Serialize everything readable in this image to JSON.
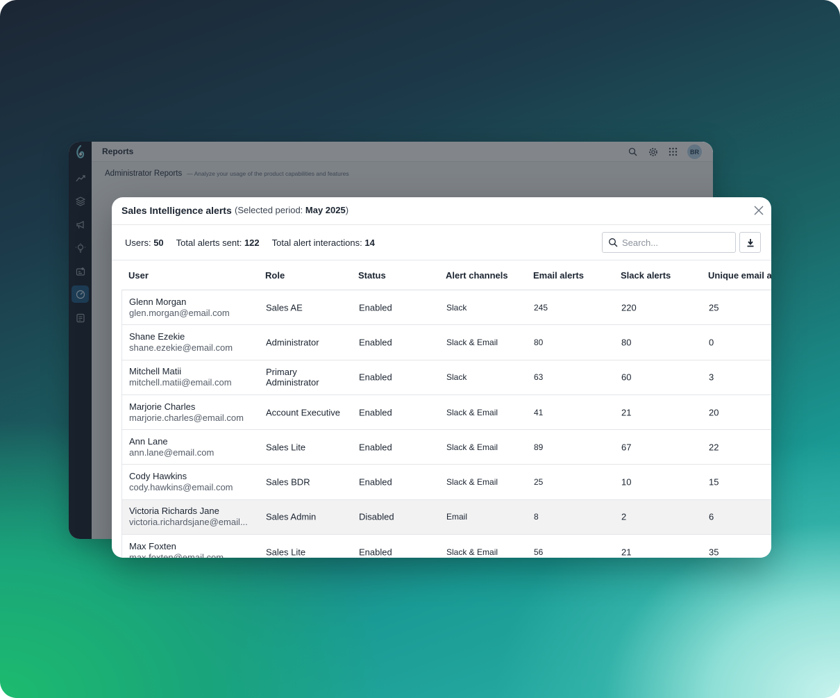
{
  "app": {
    "title": "Reports",
    "avatar_initials": "BR",
    "subtitle": "Administrator Reports",
    "subtitle_desc": "— Analyze your usage of the product capabilities and features",
    "sidebar_icons": [
      "trend-icon",
      "layers-icon",
      "megaphone-icon",
      "lightbulb-icon",
      "id-card-icon",
      "gauge-icon",
      "report-icon"
    ],
    "active_sidebar": "gauge-icon"
  },
  "modal": {
    "title": "Sales Intelligence alerts",
    "period_prefix": "(Selected period: ",
    "period_value": "May 2025",
    "period_suffix": ")",
    "stats": {
      "users_label": "Users:",
      "users_value": "50",
      "sent_label": "Total alerts sent:",
      "sent_value": "122",
      "interactions_label": "Total alert interactions:",
      "interactions_value": "14"
    },
    "search": {
      "placeholder": "Search...",
      "value": ""
    },
    "columns": [
      "User",
      "Role",
      "Status",
      "Alert channels",
      "Email alerts",
      "Slack alerts",
      "Unique email al"
    ],
    "rows": [
      {
        "name": "Glenn Morgan",
        "email": "glen.morgan@email.com",
        "role": "Sales AE",
        "status": "Enabled",
        "channels": "Slack",
        "email_alerts": "245",
        "slack_alerts": "220",
        "unique": "25"
      },
      {
        "name": "Shane Ezekie",
        "email": "shane.ezekie@email.com",
        "role": "Administrator",
        "status": "Enabled",
        "channels": "Slack & Email",
        "email_alerts": "80",
        "slack_alerts": "80",
        "unique": "0"
      },
      {
        "name": "Mitchell Matii",
        "email": "mitchell.matii@email.com",
        "role": "Primary Administrator",
        "status": "Enabled",
        "channels": "Slack",
        "email_alerts": "63",
        "slack_alerts": "60",
        "unique": "3"
      },
      {
        "name": "Marjorie Charles",
        "email": "marjorie.charles@email.com",
        "role": "Account Executive",
        "status": "Enabled",
        "channels": "Slack & Email",
        "email_alerts": "41",
        "slack_alerts": "21",
        "unique": "20"
      },
      {
        "name": "Ann Lane",
        "email": "ann.lane@email.com",
        "role": "Sales Lite",
        "status": "Enabled",
        "channels": "Slack & Email",
        "email_alerts": "89",
        "slack_alerts": "67",
        "unique": "22"
      },
      {
        "name": "Cody Hawkins",
        "email": "cody.hawkins@email.com",
        "role": "Sales BDR",
        "status": "Enabled",
        "channels": "Slack & Email",
        "email_alerts": "25",
        "slack_alerts": "10",
        "unique": "15"
      },
      {
        "name": "Victoria Richards Jane",
        "email": "victoria.richardsjane@email...",
        "role": "Sales Admin",
        "status": "Disabled",
        "channels": "Email",
        "email_alerts": "8",
        "slack_alerts": "2",
        "unique": "6"
      },
      {
        "name": "Max Foxten",
        "email": "max.foxten@email.com",
        "role": "Sales Lite",
        "status": "Enabled",
        "channels": "Slack & Email",
        "email_alerts": "56",
        "slack_alerts": "21",
        "unique": "35"
      }
    ],
    "highlighted_row": 6
  },
  "colors": {
    "sidebar": "#17212d",
    "active_icon_bg": "#1f5c86",
    "highlight_row": "#f2f2f3",
    "text": "#1b2430"
  }
}
